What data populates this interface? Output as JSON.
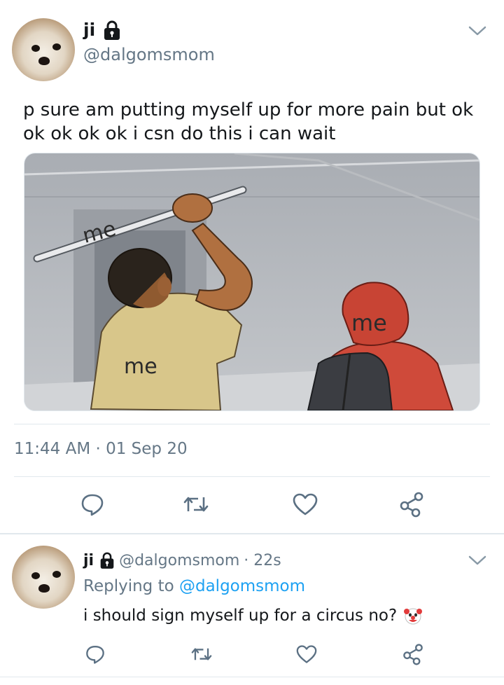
{
  "tweet": {
    "display_name": "ji",
    "handle": "@dalgomsmom",
    "text": "p sure am putting myself up for more pain but ok ok ok ok ok i csn do this i can wait",
    "timestamp": "11:44 AM · 01 Sep 20",
    "media": {
      "labels": [
        "me",
        "me",
        "me"
      ]
    }
  },
  "reply": {
    "display_name": "ji",
    "handle": "@dalgomsmom",
    "age": "· 22s",
    "replying_prefix": "Replying to",
    "replying_to": "@dalgomsmom",
    "text": "i should sign myself up for a circus no?"
  },
  "colors": {
    "link": "#1da1f2",
    "secondary_text": "#657786",
    "icon": "#5b7083",
    "divider": "#e1e8ed"
  }
}
